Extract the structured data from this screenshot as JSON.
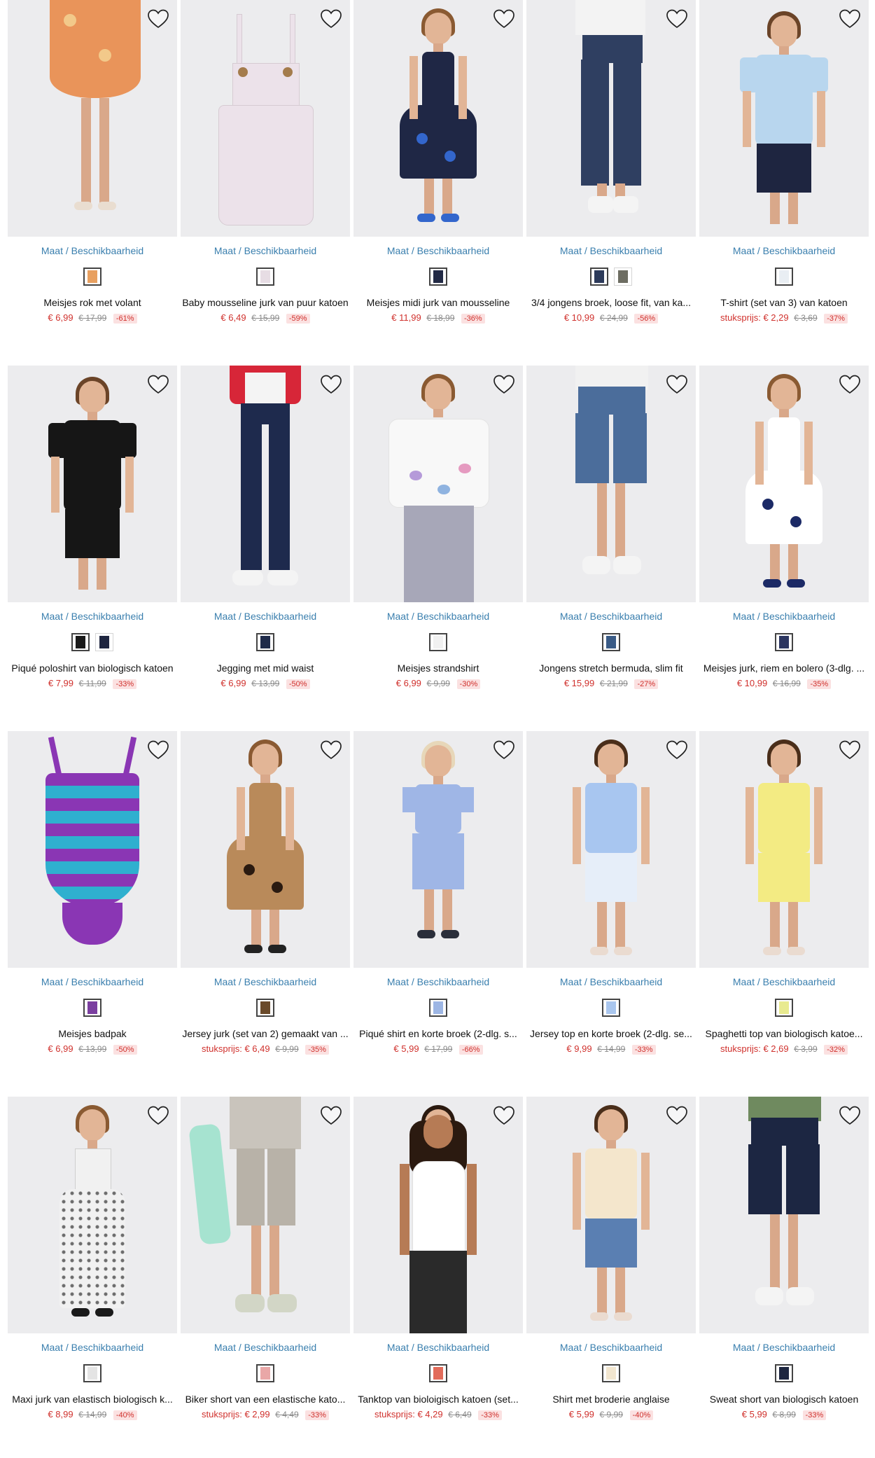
{
  "common": {
    "maat_label": "Maat / Beschikbaarheid"
  },
  "colors": {
    "price": "#d0312d",
    "link": "#3a7fae",
    "image_bg": "#ececee",
    "discount_bg": "#fbe1e1"
  },
  "rows": [
    [
      {
        "name": "Meisjes rok met volant",
        "prefix": "",
        "price": "€ 6,99",
        "was": "€ 17,99",
        "disc": "-61%",
        "swatches": [
          "#e8a060"
        ],
        "art": {
          "type": "skirt",
          "main": "#e9945a",
          "accent": "#f2c98a"
        }
      },
      {
        "name": "Baby mousseline jurk van puur katoen",
        "prefix": "",
        "price": "€ 6,49",
        "was": "€ 15,99",
        "disc": "-59%",
        "swatches": [
          "#e7dde4"
        ],
        "art": {
          "type": "flat-dress",
          "main": "#ece2ea",
          "accent": "#a47c4c"
        }
      },
      {
        "name": "Meisjes midi jurk van mousseline",
        "prefix": "",
        "price": "€ 11,99",
        "was": "€ 18,99",
        "disc": "-36%",
        "swatches": [
          "#222a45"
        ],
        "art": {
          "type": "girl-dress",
          "main": "#1f2745",
          "accent": "#3366cc"
        }
      },
      {
        "name": "3/4 jongens broek, loose fit, van ka...",
        "prefix": "",
        "price": "€ 10,99",
        "was": "€ 24,99",
        "disc": "-56%",
        "swatches": [
          "#2c3a5a",
          "#6d6d62"
        ],
        "art": {
          "type": "pants",
          "main": "#2f3f61",
          "accent": "#f4f4f4"
        }
      },
      {
        "name": "T-shirt (set van 3) van katoen",
        "prefix": "stuksprijs:",
        "price": "€ 2,29",
        "was": "€ 3,69",
        "disc": "-37%",
        "swatches": [
          "#e9eef3"
        ],
        "art": {
          "type": "boy-tee",
          "main": "#b8d6ee",
          "accent": "#1e2540"
        }
      }
    ],
    [
      {
        "name": "Piqué poloshirt van biologisch katoen",
        "prefix": "",
        "price": "€ 7,99",
        "was": "€ 11,99",
        "disc": "-33%",
        "swatches": [
          "#1a1a1a",
          "#1e2540"
        ],
        "art": {
          "type": "boy-tee",
          "main": "#161616",
          "accent": "#161616"
        }
      },
      {
        "name": "Jegging met mid waist",
        "prefix": "",
        "price": "€ 6,99",
        "was": "€ 13,99",
        "disc": "-50%",
        "swatches": [
          "#1f2b4a"
        ],
        "art": {
          "type": "jeggings",
          "main": "#1e2a4d",
          "accent": "#d72638"
        }
      },
      {
        "name": "Meisjes strandshirt",
        "prefix": "",
        "price": "€ 6,99",
        "was": "€ 9,99",
        "disc": "-30%",
        "swatches": [
          "#f1f1f1"
        ],
        "art": {
          "type": "girl-top",
          "main": "#f8f8f8",
          "accent": "#a7a7b8"
        }
      },
      {
        "name": "Jongens stretch bermuda, slim fit",
        "prefix": "",
        "price": "€ 15,99",
        "was": "€ 21,99",
        "disc": "-27%",
        "swatches": [
          "#3a5b86"
        ],
        "art": {
          "type": "bermuda",
          "main": "#4b6d9b",
          "accent": "#f4f4f4"
        }
      },
      {
        "name": "Meisjes jurk, riem en bolero (3-dlg. ...",
        "prefix": "",
        "price": "€ 10,99",
        "was": "€ 16,99",
        "disc": "-35%",
        "swatches": [
          "#2b3560"
        ],
        "art": {
          "type": "girl-dress",
          "main": "#ffffff",
          "accent": "#1c2a66"
        }
      }
    ],
    [
      {
        "name": "Meisjes badpak",
        "prefix": "",
        "price": "€ 6,99",
        "was": "€ 13,99",
        "disc": "-50%",
        "swatches": [
          "#7b3fa0"
        ],
        "art": {
          "type": "swimsuit",
          "main": "#8a36b4",
          "accent": "#2fb0cf"
        }
      },
      {
        "name": "Jersey jurk (set van 2) gemaakt van ...",
        "prefix": "stuksprijs:",
        "price": "€ 6,49",
        "was": "€ 9,99",
        "disc": "-35%",
        "swatches": [
          "#6a4a2a"
        ],
        "art": {
          "type": "girl-dress",
          "main": "#b98a5a",
          "accent": "#2a1a10"
        }
      },
      {
        "name": "Piqué shirt en korte broek (2-dlg. s...",
        "prefix": "",
        "price": "€ 5,99",
        "was": "€ 17,99",
        "disc": "-66%",
        "swatches": [
          "#9db6e4"
        ],
        "art": {
          "type": "boy-set",
          "main": "#9fb6e6",
          "accent": "#d7c7b0"
        }
      },
      {
        "name": "Jersey top en korte broek (2-dlg. se...",
        "prefix": "",
        "price": "€ 9,99",
        "was": "€ 14,99",
        "disc": "-33%",
        "swatches": [
          "#a9c6ee"
        ],
        "art": {
          "type": "girl-set",
          "main": "#a8c6f0",
          "accent": "#e6eef9"
        }
      },
      {
        "name": "Spaghetti top van biologisch katoe...",
        "prefix": "stuksprijs:",
        "price": "€ 2,69",
        "was": "€ 3,99",
        "disc": "-32%",
        "swatches": [
          "#e8ea90"
        ],
        "art": {
          "type": "girl-set",
          "main": "#f3eb83",
          "accent": "#f3eb83"
        }
      }
    ],
    [
      {
        "name": "Maxi jurk van elastisch biologisch k...",
        "prefix": "",
        "price": "€ 8,99",
        "was": "€ 14,99",
        "disc": "-40%",
        "swatches": [
          "#e4e4e4"
        ],
        "art": {
          "type": "maxi",
          "main": "#f1f1f1",
          "accent": "#6d6d6d"
        }
      },
      {
        "name": "Biker short van een elastische kato...",
        "prefix": "stuksprijs:",
        "price": "€ 2,99",
        "was": "€ 4,49",
        "disc": "-33%",
        "swatches": [
          "#e9a7a7"
        ],
        "art": {
          "type": "biker",
          "main": "#b8b2a8",
          "accent": "#a6e3d0"
        }
      },
      {
        "name": "Tanktop van bioloigisch katoen (set...",
        "prefix": "stuksprijs:",
        "price": "€ 4,29",
        "was": "€ 6,49",
        "disc": "-33%",
        "swatches": [
          "#e26b5a"
        ],
        "art": {
          "type": "tank",
          "main": "#ffffff",
          "accent": "#2a2a2a"
        }
      },
      {
        "name": "Shirt met broderie anglaise",
        "prefix": "",
        "price": "€ 5,99",
        "was": "€ 9,99",
        "disc": "-40%",
        "swatches": [
          "#f2e6cf"
        ],
        "art": {
          "type": "girl-set",
          "main": "#f4e6cc",
          "accent": "#5a7fb2"
        }
      },
      {
        "name": "Sweat short van biologisch katoen",
        "prefix": "",
        "price": "€ 5,99",
        "was": "€ 8,99",
        "disc": "-33%",
        "swatches": [
          "#1d2640"
        ],
        "art": {
          "type": "bermuda",
          "main": "#1c2642",
          "accent": "#6f8a5f"
        }
      }
    ]
  ]
}
